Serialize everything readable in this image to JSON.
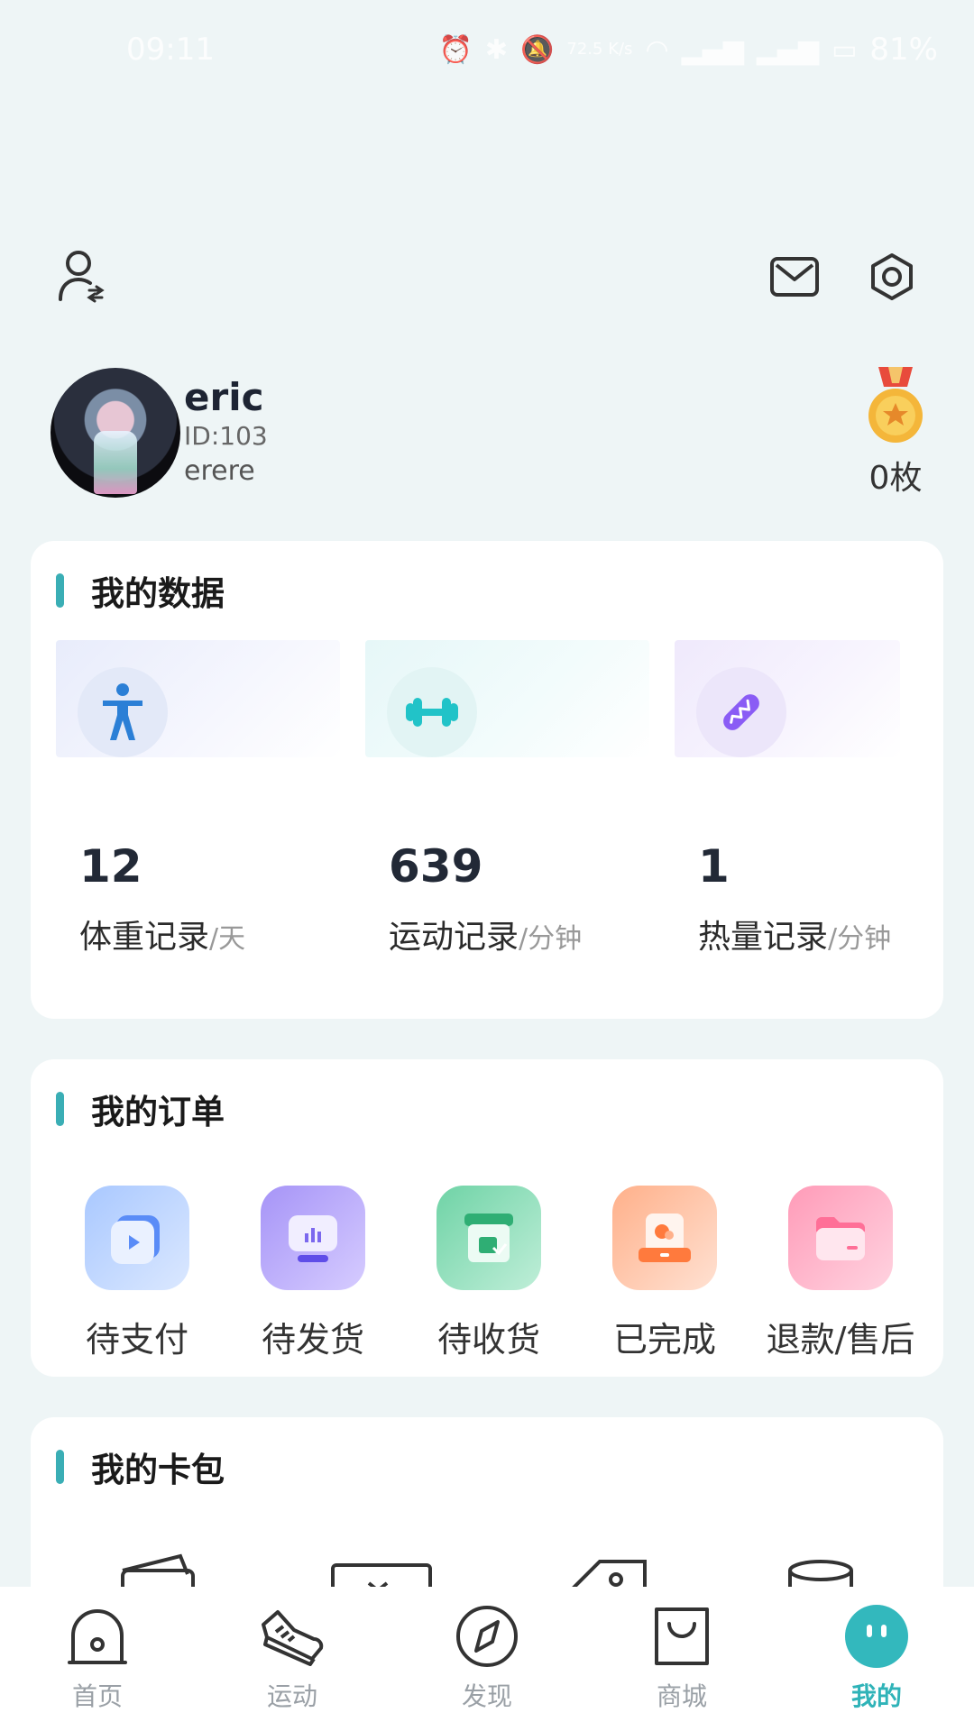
{
  "status_bar": {
    "time": "09:11",
    "speed": "72.5 K/s",
    "battery": "81%"
  },
  "profile": {
    "username": "eric",
    "id_text": "ID:103",
    "signature": "erere",
    "medal_count": "0枚"
  },
  "my_data": {
    "title": "我的数据",
    "items": [
      {
        "value": "12",
        "label": "体重记录",
        "unit": "/天",
        "icon": "person-icon",
        "color": "#2b7fd6"
      },
      {
        "value": "639",
        "label": "运动记录",
        "unit": "/分钟",
        "icon": "dumbbell-icon",
        "color": "#21c3c8"
      },
      {
        "value": "1",
        "label": "热量记录",
        "unit": "/分钟",
        "icon": "bread-icon",
        "color": "#8a5cf5"
      }
    ]
  },
  "my_orders": {
    "title": "我的订单",
    "items": [
      {
        "label": "待支付",
        "icon": "wallet-pay-icon",
        "color": "#8fb6ff"
      },
      {
        "label": "待发货",
        "icon": "monitor-chart-icon",
        "color": "#9f8df5"
      },
      {
        "label": "待收货",
        "icon": "package-receive-icon",
        "color": "#62cf9f"
      },
      {
        "label": "已完成",
        "icon": "box-complete-icon",
        "color": "#ff9a6a"
      },
      {
        "label": "退款/售后",
        "icon": "folder-refund-icon",
        "color": "#ff97b5"
      }
    ]
  },
  "my_card_bag": {
    "title": "我的卡包"
  },
  "bottom_nav": {
    "items": [
      {
        "label": "首页",
        "icon": "home-icon"
      },
      {
        "label": "运动",
        "icon": "sneaker-icon"
      },
      {
        "label": "发现",
        "icon": "compass-icon"
      },
      {
        "label": "商城",
        "icon": "shopping-bag-icon"
      },
      {
        "label": "我的",
        "icon": "face-icon",
        "active": true
      }
    ]
  }
}
